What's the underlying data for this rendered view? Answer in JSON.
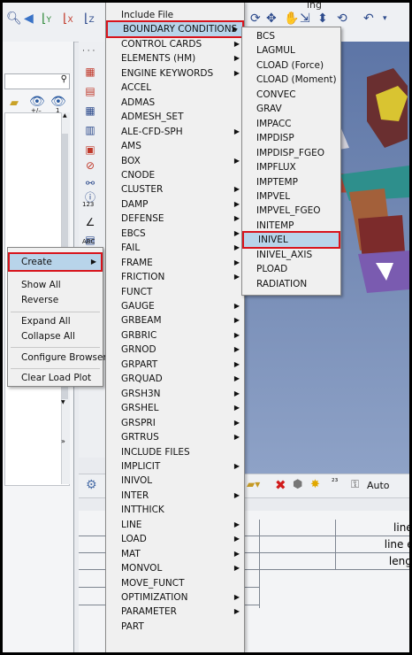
{
  "context_menu": {
    "items": [
      {
        "label": "Create",
        "selected": true,
        "has_submenu": true
      },
      {
        "label": "Show All"
      },
      {
        "label": "Reverse"
      },
      {
        "label": "Expand All"
      },
      {
        "label": "Collapse All"
      },
      {
        "label": "Configure Browser"
      },
      {
        "label": "Clear Load Plot"
      }
    ]
  },
  "main_menu": {
    "items": [
      {
        "label": "Include File"
      },
      {
        "label": "BOUNDARY CONDITIONS",
        "selected": true,
        "has_submenu": true
      },
      {
        "label": "CONTROL CARDS",
        "has_submenu": true
      },
      {
        "label": "ELEMENTS (HM)",
        "has_submenu": true
      },
      {
        "label": "ENGINE KEYWORDS",
        "has_submenu": true
      },
      {
        "label": "ACCEL"
      },
      {
        "label": "ADMAS"
      },
      {
        "label": "ADMESH_SET"
      },
      {
        "label": "ALE-CFD-SPH",
        "has_submenu": true
      },
      {
        "label": "AMS"
      },
      {
        "label": "BOX",
        "has_submenu": true
      },
      {
        "label": "CNODE"
      },
      {
        "label": "CLUSTER",
        "has_submenu": true
      },
      {
        "label": "DAMP",
        "has_submenu": true
      },
      {
        "label": "DEFENSE",
        "has_submenu": true
      },
      {
        "label": "EBCS",
        "has_submenu": true
      },
      {
        "label": "FAIL",
        "has_submenu": true
      },
      {
        "label": "FRAME",
        "has_submenu": true
      },
      {
        "label": "FRICTION",
        "has_submenu": true
      },
      {
        "label": "FUNCT"
      },
      {
        "label": "GAUGE",
        "has_submenu": true
      },
      {
        "label": "GRBEAM",
        "has_submenu": true
      },
      {
        "label": "GRBRIC",
        "has_submenu": true
      },
      {
        "label": "GRNOD",
        "has_submenu": true
      },
      {
        "label": "GRPART",
        "has_submenu": true
      },
      {
        "label": "GRQUAD",
        "has_submenu": true
      },
      {
        "label": "GRSH3N",
        "has_submenu": true
      },
      {
        "label": "GRSHEL",
        "has_submenu": true
      },
      {
        "label": "GRSPRI",
        "has_submenu": true
      },
      {
        "label": "GRTRUS",
        "has_submenu": true
      },
      {
        "label": "INCLUDE FILES"
      },
      {
        "label": "IMPLICIT",
        "has_submenu": true
      },
      {
        "label": "INIVOL"
      },
      {
        "label": "INTER",
        "has_submenu": true
      },
      {
        "label": "INTTHICK"
      },
      {
        "label": "LINE",
        "has_submenu": true
      },
      {
        "label": "LOAD",
        "has_submenu": true
      },
      {
        "label": "MAT",
        "has_submenu": true
      },
      {
        "label": "MONVOL",
        "has_submenu": true
      },
      {
        "label": "MOVE_FUNCT"
      },
      {
        "label": "OPTIMIZATION",
        "has_submenu": true
      },
      {
        "label": "PARAMETER",
        "has_submenu": true
      },
      {
        "label": "PART"
      }
    ]
  },
  "sub_menu": {
    "items": [
      {
        "label": "BCS"
      },
      {
        "label": "LAGMUL"
      },
      {
        "label": "CLOAD (Force)"
      },
      {
        "label": "CLOAD (Moment)"
      },
      {
        "label": "CONVEC"
      },
      {
        "label": "GRAV"
      },
      {
        "label": "IMPACC"
      },
      {
        "label": "IMPDISP"
      },
      {
        "label": "IMPDISP_FGEO"
      },
      {
        "label": "IMPFLUX"
      },
      {
        "label": "IMPTEMP"
      },
      {
        "label": "IMPVEL"
      },
      {
        "label": "IMPVEL_FGEO"
      },
      {
        "label": "INITEMP"
      },
      {
        "label": "INIVEL",
        "selected": true
      },
      {
        "label": "INIVEL_AXIS"
      },
      {
        "label": "PLOAD"
      },
      {
        "label": "RADIATION"
      }
    ]
  },
  "table": {
    "rows": [
      "lines",
      "line edit",
      "length"
    ]
  },
  "bottom_toolbar": {
    "auto_label": "Auto"
  },
  "left_icons": {
    "counter_label": "123",
    "abc_label": "ABC",
    "minus_label": "+/–",
    "one_label": "1"
  },
  "toolbar": {
    "title_fragment": "ing",
    "axis_labels": [
      "Y",
      "X",
      "Z"
    ]
  },
  "colors": {
    "selection_border": "#d8141c",
    "selection_fill": "#b8d4ea",
    "viewport_bg": "#6f86b1"
  }
}
